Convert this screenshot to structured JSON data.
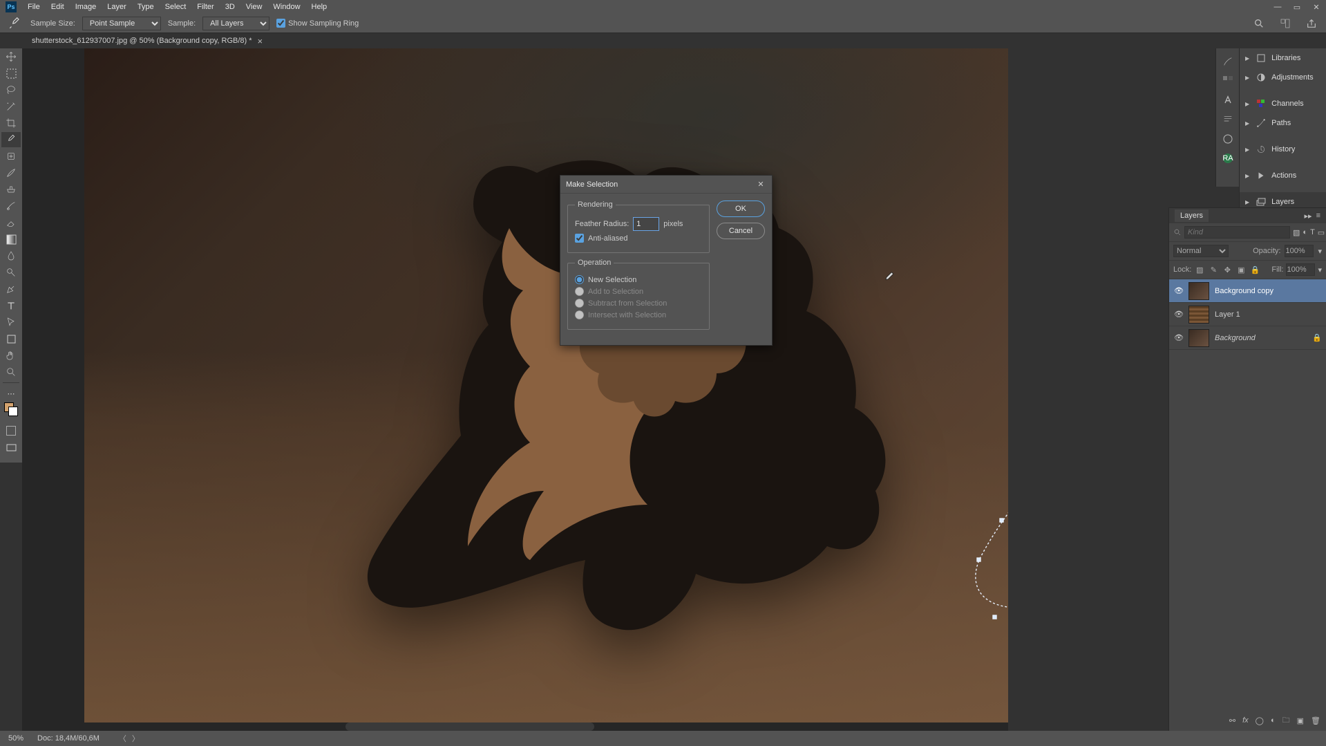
{
  "menu": {
    "file": "File",
    "edit": "Edit",
    "image": "Image",
    "layer": "Layer",
    "type": "Type",
    "select": "Select",
    "filter": "Filter",
    "threeD": "3D",
    "view": "View",
    "window": "Window",
    "help": "Help"
  },
  "options": {
    "sampleSizeLabel": "Sample Size:",
    "sampleSizeValue": "Point Sample",
    "sampleLabel": "Sample:",
    "sampleValue": "All Layers",
    "showSamplingRing": "Show Sampling Ring"
  },
  "tab": {
    "title": "shutterstock_612937007.jpg @ 50% (Background copy, RGB/8) *"
  },
  "dialog": {
    "title": "Make Selection",
    "rendering": "Rendering",
    "featherLabel": "Feather Radius:",
    "featherValue": "1",
    "pixels": "pixels",
    "antiAliased": "Anti-aliased",
    "operation": "Operation",
    "opNew": "New Selection",
    "opAdd": "Add to Selection",
    "opSub": "Subtract from Selection",
    "opInt": "Intersect with Selection",
    "ok": "OK",
    "cancel": "Cancel"
  },
  "rightPanels": {
    "libraries": "Libraries",
    "adjustments": "Adjustments",
    "channels": "Channels",
    "paths": "Paths",
    "history": "History",
    "actions": "Actions",
    "layers": "Layers"
  },
  "layers": {
    "tab": "Layers",
    "kind": "Kind",
    "blend": "Normal",
    "opacityLabel": "Opacity:",
    "opacityValue": "100%",
    "lockLabel": "Lock:",
    "fillLabel": "Fill:",
    "fillValue": "100%",
    "items": [
      {
        "name": "Background copy",
        "selected": true,
        "locked": false
      },
      {
        "name": "Layer 1",
        "selected": false,
        "locked": false
      },
      {
        "name": "Background",
        "selected": false,
        "locked": true,
        "italic": true
      }
    ]
  },
  "status": {
    "zoom": "50%",
    "doc": "Doc: 18,4M/60,6M"
  }
}
